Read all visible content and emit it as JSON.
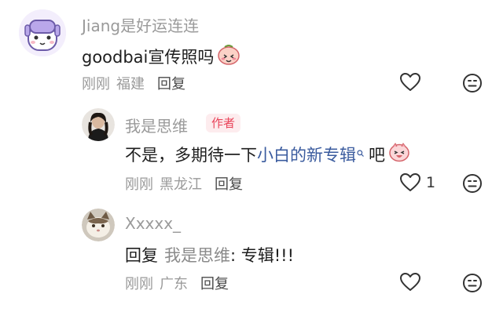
{
  "comments": [
    {
      "username": "Jiang是好运连连",
      "text": "goodbai宣传照吗",
      "time": "刚刚",
      "location": "福建",
      "reply_label": "回复",
      "likes": ""
    },
    {
      "username": "我是思维",
      "badge": "作者",
      "text_before": "不是，多期待一下 ",
      "link_text": "小白的新专辑",
      "text_after": " 吧",
      "time": "刚刚",
      "location": "黑龙江",
      "reply_label": "回复",
      "likes": "1"
    },
    {
      "username": "Xxxxx_",
      "reply_prefix": "回复",
      "mention": "我是思维",
      "text_after": ": 专辑!!!",
      "time": "刚刚",
      "location": "广东",
      "reply_label": "回复",
      "likes": ""
    }
  ],
  "colors": {
    "username": "#9a9a9a",
    "link": "#3a5b9e",
    "badge_text": "#e9445a",
    "badge_bg": "#fdecee"
  },
  "icons": [
    "heart-outline-icon",
    "dislike-face-icon",
    "search-mini-icon"
  ]
}
